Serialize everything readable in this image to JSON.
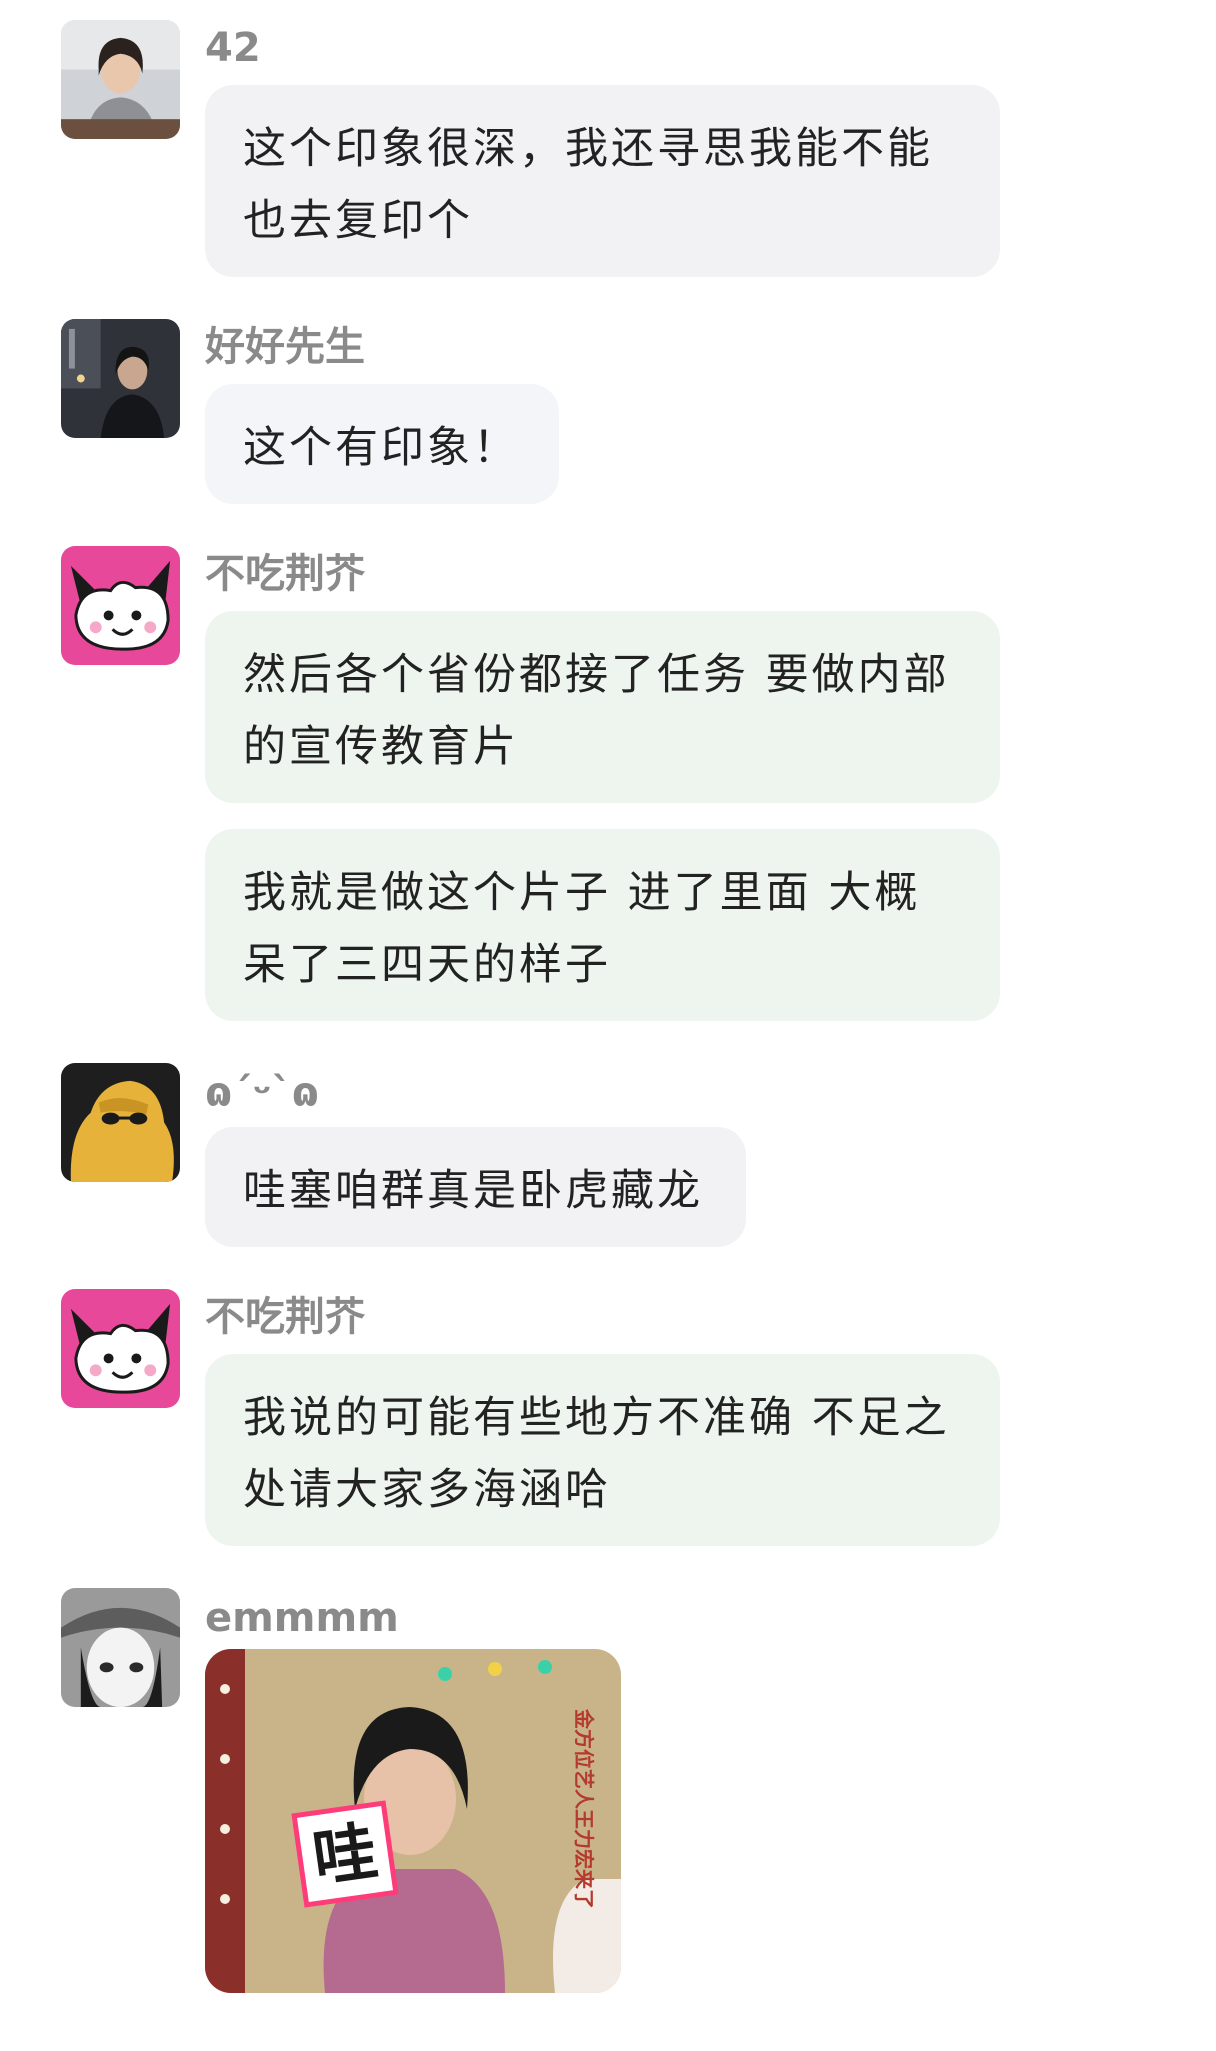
{
  "messages": [
    {
      "sender": "42",
      "text": "这个印象很深，我还寻思我能不能也去复印个",
      "avatar_icon": "woman-portrait-avatar"
    },
    {
      "sender": "好好先生",
      "text": "这个有印象！",
      "avatar_icon": "man-night-street-avatar"
    },
    {
      "sender": "不吃荆芥",
      "text": "然后各个省份都接了任务 要做内部的宣传教育片",
      "avatar_icon": "cartoon-cat-avatar"
    },
    {
      "text": "我就是做这个片子 进了里面 大概呆了三四天的样子"
    },
    {
      "sender": "ɷˊᵕˋɷ",
      "text": "哇塞咱群真是卧虎藏龙",
      "avatar_icon": "yellow-sweater-avatar"
    },
    {
      "sender": "不吃荆芥",
      "text": "我说的可能有些地方不准确 不足之处请大家多海涵哈",
      "avatar_icon": "cartoon-cat-avatar"
    },
    {
      "sender": "emmmm",
      "avatar_icon": "girl-bucket-hat-avatar",
      "sticker": {
        "caption": "哇",
        "icon": "tv-show-reaction-sticker",
        "side_text": "金方位艺人王力宏来了"
      }
    }
  ],
  "colors": {
    "bubble_gray": "#f2f2f4",
    "bubble_green": "#edf5ee",
    "name_text": "#8a8a8a",
    "message_text": "#222222",
    "cat_avatar_bg": "#e8489a"
  }
}
